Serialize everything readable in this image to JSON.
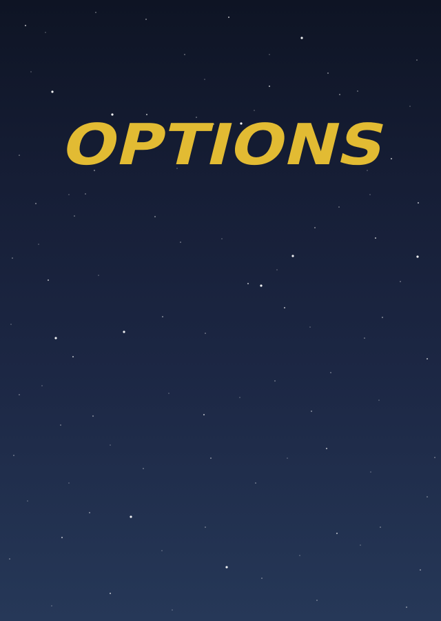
{
  "screen": {
    "title": "OPTIONS",
    "title_color": "#e2bb33",
    "background_top": "#0e1424",
    "background_bottom": "#263858",
    "star_color": "#ffffff"
  }
}
